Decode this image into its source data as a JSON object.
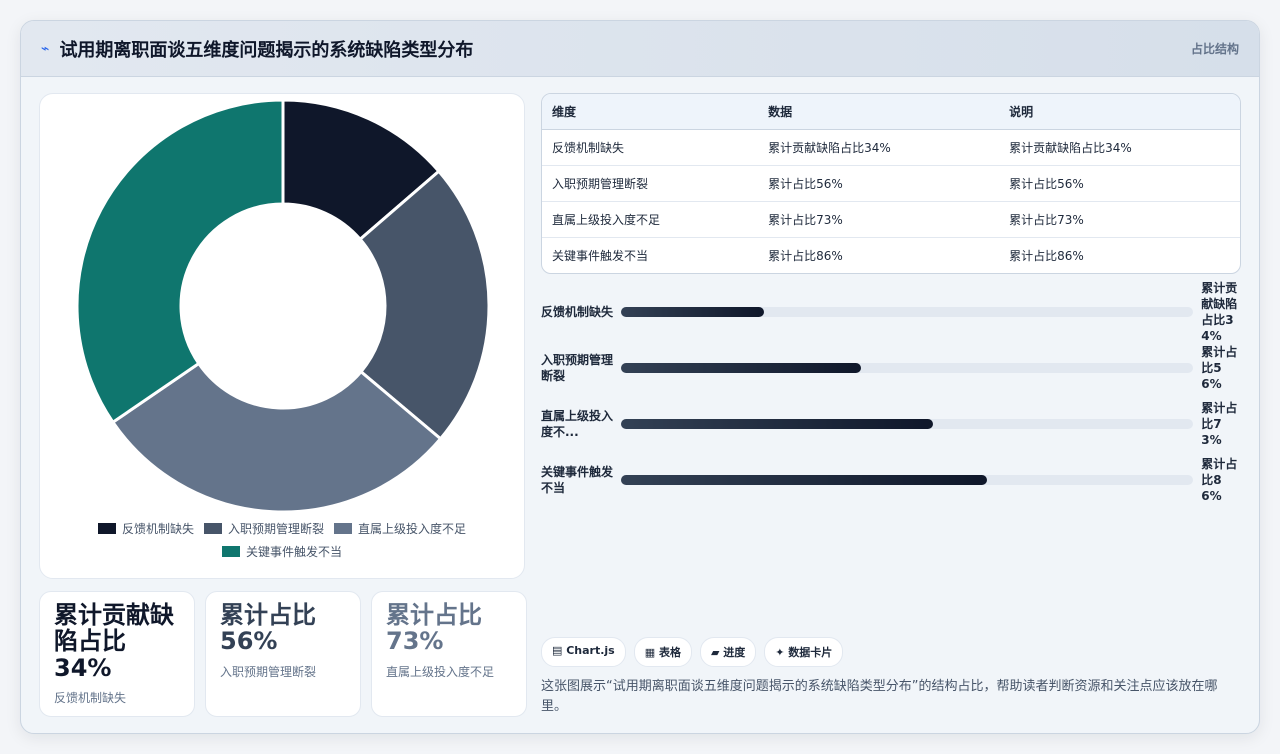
{
  "header": {
    "icon": "⌁",
    "title": "试用期离职面谈五维度问题揭示的系统缺陷类型分布",
    "mode": "占比结构"
  },
  "colors": [
    "#0f172a",
    "#475569",
    "#64748b",
    "#0f766e"
  ],
  "chart_data": {
    "type": "pie",
    "style": "doughnut",
    "categories": [
      "反馈机制缺失",
      "入职预期管理断裂",
      "直属上级投入度不足",
      "关键事件触发不当"
    ],
    "values": [
      34,
      56,
      73,
      86
    ],
    "legend_position": "bottom"
  },
  "kpis": [
    {
      "value": "累计贡献缺陷占比34%",
      "label": "反馈机制缺失",
      "color": "#0f172a"
    },
    {
      "value": "累计占比56%",
      "label": "入职预期管理断裂",
      "color": "#334155"
    },
    {
      "value": "累计占比73%",
      "label": "直属上级投入度不足",
      "color": "#64748b"
    }
  ],
  "table": {
    "headers": [
      "维度",
      "数据",
      "说明"
    ],
    "rows": [
      [
        "反馈机制缺失",
        "累计贡献缺陷占比34%",
        "累计贡献缺陷占比34%"
      ],
      [
        "入职预期管理断裂",
        "累计占比56%",
        "累计占比56%"
      ],
      [
        "直属上级投入度不足",
        "累计占比73%",
        "累计占比73%"
      ],
      [
        "关键事件触发不当",
        "累计占比86%",
        "累计占比86%"
      ]
    ]
  },
  "bars": [
    {
      "label": "反馈机制缺失",
      "value_text": "累计贡献缺陷占比34%",
      "percent": 25
    },
    {
      "label": "入职预期管理断裂",
      "value_text": "累计占比56%",
      "percent": 42
    },
    {
      "label": "直属上级投入度不...",
      "value_text": "累计占比73%",
      "percent": 54.5
    },
    {
      "label": "关键事件触发不当",
      "value_text": "累计占比86%",
      "percent": 64
    }
  ],
  "chips": [
    "▤ Chart.js",
    "▦ 表格",
    "▰ 进度",
    "✦ 数据卡片"
  ],
  "note": "这张图展示“试用期离职面谈五维度问题揭示的系统缺陷类型分布”的结构占比，帮助读者判断资源和关注点应该放在哪里。"
}
